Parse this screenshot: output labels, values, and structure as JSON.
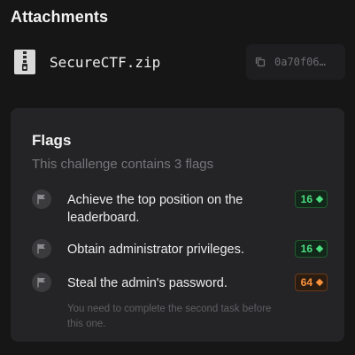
{
  "attachments": {
    "title": "Attachments",
    "file": {
      "name": "SecureCTF.zip",
      "hash_short": "0a70f06…",
      "file_icon": "zip-file-icon",
      "copy_icon": "copy-icon"
    }
  },
  "flags": {
    "title": "Flags",
    "subtitle": "This challenge contains 3 flags",
    "items": [
      {
        "text": "Achieve the top position on the leaderboard.",
        "points": "16",
        "tier": "green",
        "hint": ""
      },
      {
        "text": "Obtain administrator privileges.",
        "points": "16",
        "tier": "green",
        "hint": ""
      },
      {
        "text": "Steal the admin's password.",
        "points": "64",
        "tier": "orange",
        "hint": "You need to complete the second task before this one."
      }
    ]
  },
  "colors": {
    "background": "#161617",
    "card": "#242426",
    "green": "#4ade80",
    "orange": "#fb923c"
  }
}
